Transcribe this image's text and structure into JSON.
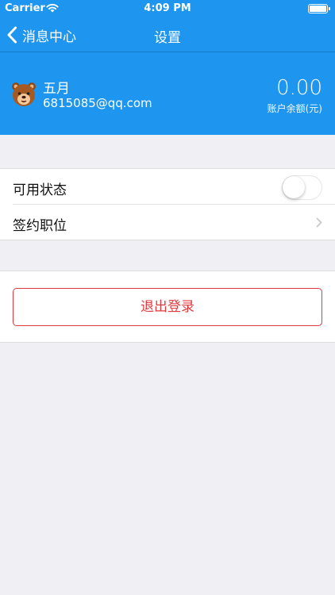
{
  "statusbar": {
    "carrier": "Carrier",
    "time": "4:09 PM"
  },
  "navbar": {
    "back_label": "消息中心",
    "title": "设置"
  },
  "account": {
    "name": "五月",
    "email": "6815085@qq.com",
    "balance_value": "0.00",
    "balance_label": "账户余额(元)"
  },
  "settings": {
    "available_status_label": "可用状态",
    "available_status_on": false,
    "contract_position_label": "签约职位"
  },
  "logout": {
    "label": "退出登录"
  },
  "colors": {
    "header_bg": "#1e95ee",
    "page_bg": "#efeff4",
    "logout_red": "#e0393e"
  }
}
